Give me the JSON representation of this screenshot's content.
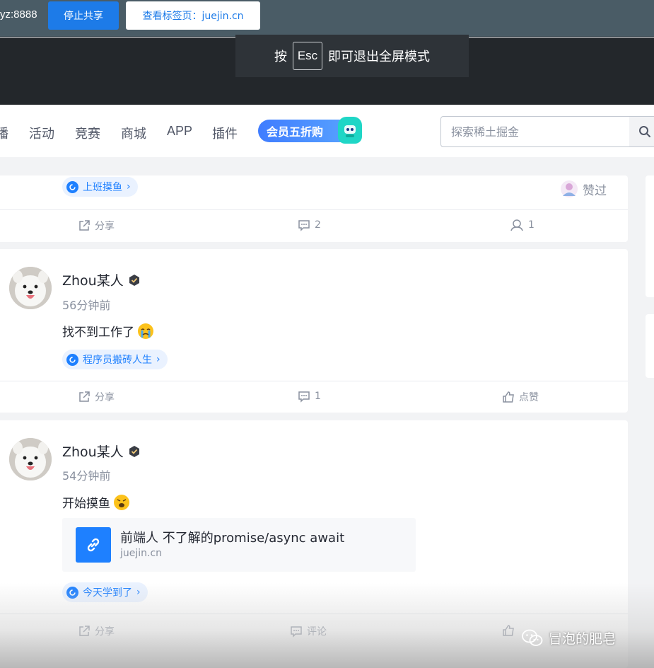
{
  "share_bar": {
    "host": "yz:8888",
    "stop_label": "停止共享",
    "view_tab_label": "查看标签页：juejin.cn"
  },
  "fullscreen_notice": {
    "prefix": "按",
    "key": "Esc",
    "suffix": "即可退出全屏模式"
  },
  "nav": {
    "items": [
      "播",
      "活动",
      "竞赛",
      "商城",
      "APP",
      "插件"
    ],
    "vip_label": "会员五折购",
    "search_placeholder": "探索稀土掘金"
  },
  "posts": [
    {
      "topic": "上班摸鱼",
      "liked_label": "赞过",
      "share_label": "分享",
      "comments": "2",
      "likes": "1"
    },
    {
      "author": "Zhou某人",
      "time": "56分钟前",
      "content": "找不到工作了",
      "topic": "程序员搬砖人生",
      "share_label": "分享",
      "comments": "1",
      "like_label": "点赞"
    },
    {
      "author": "Zhou某人",
      "time": "54分钟前",
      "content": "开始摸鱼",
      "link_title": "前端人 不了解的promise/async await",
      "link_domain": "juejin.cn",
      "topic": "今天学到了",
      "share_label": "分享",
      "comment_label": "评论"
    }
  ],
  "watermark": "冒泡的肥皂",
  "colors": {
    "accent": "#1e80ff",
    "share_bar": "#4a5c66",
    "dark_band": "#23272b"
  }
}
